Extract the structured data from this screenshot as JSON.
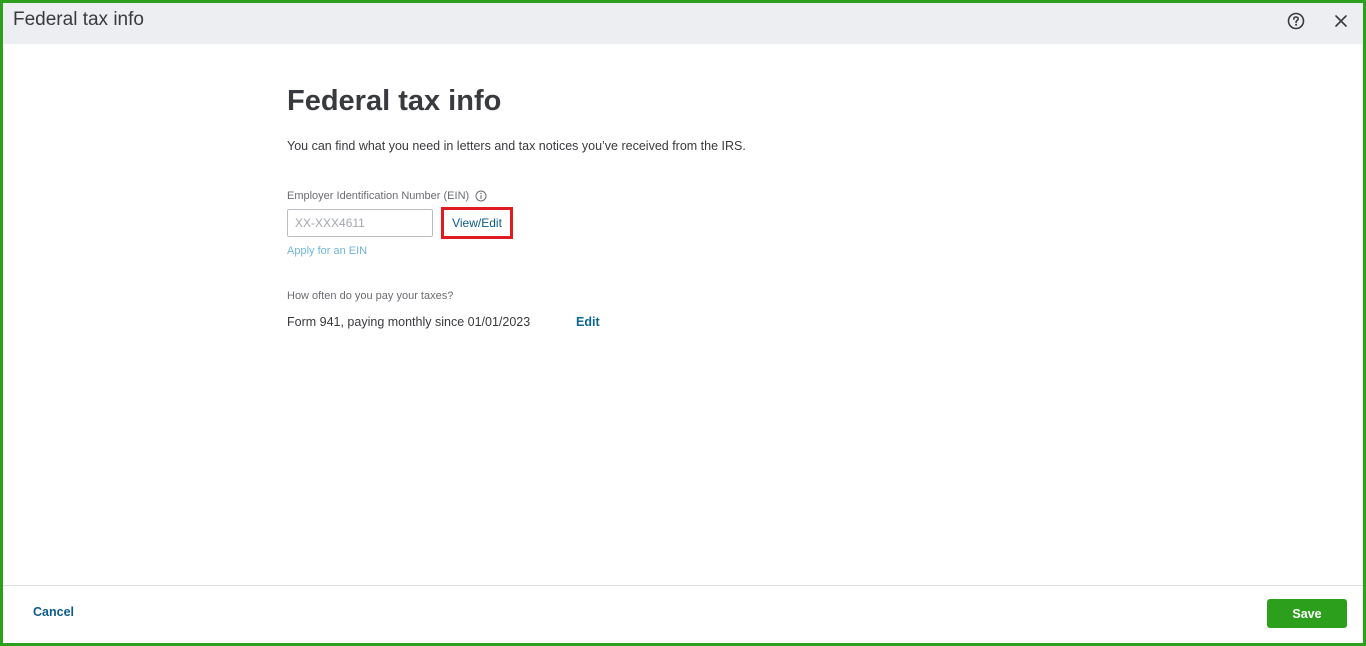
{
  "window": {
    "title": "Federal tax info",
    "help_icon": "help-circle-icon",
    "close_icon": "close-icon"
  },
  "main": {
    "heading": "Federal tax info",
    "description": "You can find what you need in letters and tax notices you’ve received from the IRS.",
    "ein": {
      "label": "Employer Identification Number (EIN)",
      "info_icon": "info-icon",
      "placeholder": "XX-XXX4611",
      "view_edit_label": "View/Edit",
      "apply_link": "Apply for an EIN"
    },
    "frequency": {
      "label": "How often do you pay your taxes?",
      "value": "Form 941, paying monthly since 01/01/2023",
      "edit_label": "Edit"
    }
  },
  "footer": {
    "cancel_label": "Cancel",
    "save_label": "Save"
  },
  "colors": {
    "accent_green": "#2ca01c",
    "link_blue": "#0b5b8c",
    "highlight_red": "#e11b22",
    "titlebar_bg": "#eceef1"
  }
}
